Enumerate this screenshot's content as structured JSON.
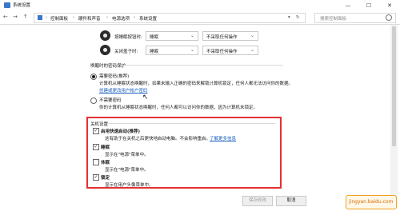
{
  "window": {
    "title": "系统设置",
    "minimize_glyph": "—",
    "maximize_glyph": "☐",
    "close_glyph": "✕"
  },
  "nav": {
    "back_glyph": "←",
    "forward_glyph": "→",
    "up_glyph": "↑",
    "breadcrumb": [
      "控制面板",
      "硬件和声音",
      "电源选项",
      "系统设置"
    ],
    "separator": "›",
    "refresh_glyph": "↻",
    "search_placeholder": "搜索控制面板"
  },
  "buttons_section": {
    "rows": [
      {
        "label": "按睡眠按钮时:",
        "on_battery": "睡眠",
        "plugged_in": "不采取任何操作"
      },
      {
        "label": "关闭盖子时:",
        "on_battery": "睡眠",
        "plugged_in": "不采取任何操作"
      }
    ]
  },
  "password": {
    "heading": "唤醒时的密码保护",
    "options": [
      {
        "title": "需要密码(推荐)",
        "desc1": "计算机从睡眠状态唤醒时，如果未输入正确的密码来解锁计算机锁定，任何人都无法访问你的数据。",
        "link": "创建或更改用户帐户密码",
        "selected": true
      },
      {
        "title": "不需要密码",
        "desc1": "你的计算机从睡眠状态唤醒时，任何人都可以访问你的数据，因为计算机未锁定。",
        "selected": false
      }
    ]
  },
  "shutdown": {
    "heading": "关机设置",
    "items": [
      {
        "title": "启用快速启动(推荐)",
        "desc": "这有助于在关机之后更快地启动电脑。不会影响重启。",
        "link": "了解更多信息",
        "checked": true
      },
      {
        "title": "睡眠",
        "desc": "显示在\"电源\"菜单中。",
        "checked": true
      },
      {
        "title": "休眠",
        "desc": "显示在\"电源\"菜单中。",
        "checked": false
      },
      {
        "title": "锁定",
        "desc": "显示在用户头像菜单中。",
        "checked": true
      }
    ],
    "check_glyph": "✓"
  },
  "footer": {
    "save_label": "保存修改",
    "cancel_label": "取消"
  },
  "watermark": {
    "text": "jingyan.baidu.com"
  },
  "colors": {
    "highlight_box": "#e53030",
    "link": "#1a5fbf"
  }
}
